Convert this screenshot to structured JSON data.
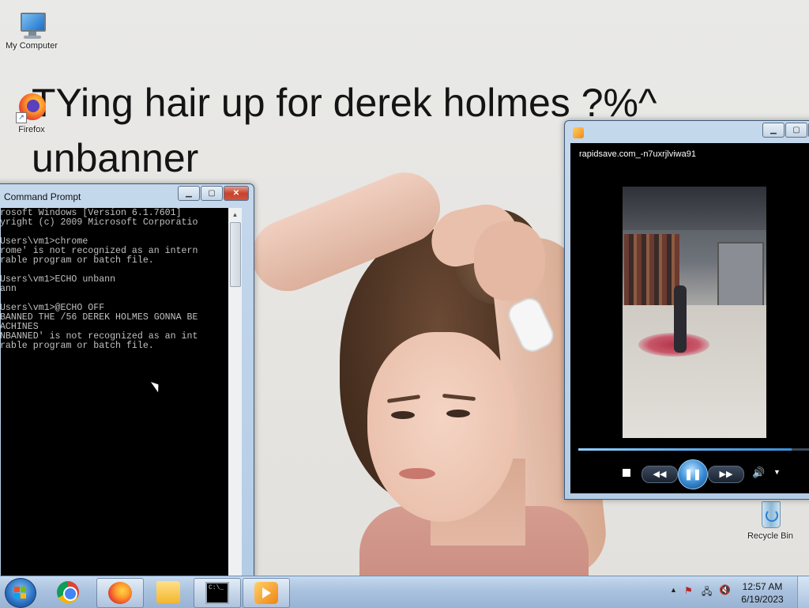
{
  "desktop": {
    "wallpaper_caption": "TYing hair up for derek holmes ?%^\nunbanner",
    "icons": [
      {
        "label": "My Computer"
      },
      {
        "label": "Firefox"
      },
      {
        "label": "Recycle Bin"
      }
    ]
  },
  "cmd_window": {
    "title": "Command Prompt",
    "console_text": "crosoft Windows [Version 6.1.7601]\npyright (c) 2009 Microsoft Corporatio\n\n\\Users\\vm1>chrome\nhrome' is not recognized as an intern\nerable program or batch file.\n\n\\Users\\vm1>ECHO unbann\nbann\n\n\\Users\\vm1>@ECHO OFF\nNBANNED THE /56 DEREK HOLMES GONNA BE\nMACHINES\nUNBANNED' is not recognized as an int\nerable program or batch file."
  },
  "media_window": {
    "title": "rapidsave.com_-n7uxrjlviwa91",
    "progress": 0.92
  },
  "taskbar": {
    "clock_time": "12:57 AM",
    "clock_date": "6/19/2023",
    "pinned": [
      "start",
      "chrome",
      "firefox",
      "explorer",
      "cmd",
      "media-player"
    ],
    "active": [
      "firefox",
      "cmd",
      "media-player"
    ]
  },
  "colors": {
    "console_bg": "#000000",
    "console_text": "#c0c0c0",
    "taskbar": "#a9c2de",
    "close_button": "#c7422c"
  }
}
